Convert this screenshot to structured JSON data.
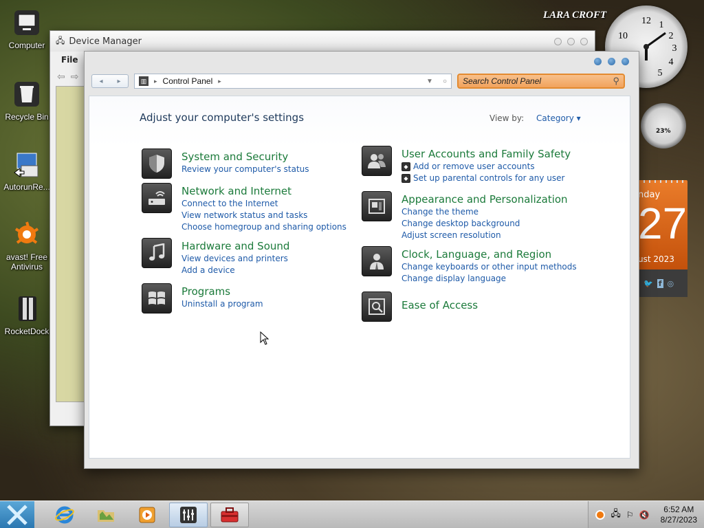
{
  "desktop": {
    "icons": [
      {
        "label": "Computer"
      },
      {
        "label": "Recycle Bin"
      },
      {
        "label": "AutorunRe..."
      },
      {
        "label": "avast! Free Antivirus"
      },
      {
        "label": "RocketDock"
      }
    ]
  },
  "gadgets": {
    "clock_numbers": [
      "12",
      "1",
      "2",
      "3",
      "4",
      "5",
      "10"
    ],
    "brand_text": "LARA CROFT",
    "meter_value": "23%",
    "calendar": {
      "weekday": "nday",
      "day": "27",
      "month_year": "ust 2023"
    }
  },
  "device_manager": {
    "title": "Device Manager",
    "menu_file": "File"
  },
  "control_panel": {
    "breadcrumb": "Control Panel",
    "search_placeholder": "Search Control Panel",
    "heading": "Adjust your computer's settings",
    "view_by_label": "View by:",
    "view_by_value": "Category",
    "categories_left": [
      {
        "title": "System and Security",
        "links": [
          "Review your computer's status"
        ]
      },
      {
        "title": "Network and Internet",
        "links": [
          "Connect to the Internet",
          "View network status and tasks",
          "Choose homegroup and sharing options"
        ]
      },
      {
        "title": "Hardware and Sound",
        "links": [
          "View devices and printers",
          "Add a device"
        ]
      },
      {
        "title": "Programs",
        "links": [
          "Uninstall a program"
        ]
      }
    ],
    "categories_right": [
      {
        "title": "User Accounts and Family Safety",
        "links": [
          "Add or remove user accounts",
          "Set up parental controls for any user"
        ]
      },
      {
        "title": "Appearance and Personalization",
        "links": [
          "Change the theme",
          "Change desktop background",
          "Adjust screen resolution"
        ]
      },
      {
        "title": "Clock, Language, and Region",
        "links": [
          "Change keyboards or other input methods",
          "Change display language"
        ]
      },
      {
        "title": "Ease of Access",
        "links": []
      }
    ]
  },
  "taskbar": {
    "time": "6:52 AM",
    "date": "8/27/2023"
  }
}
